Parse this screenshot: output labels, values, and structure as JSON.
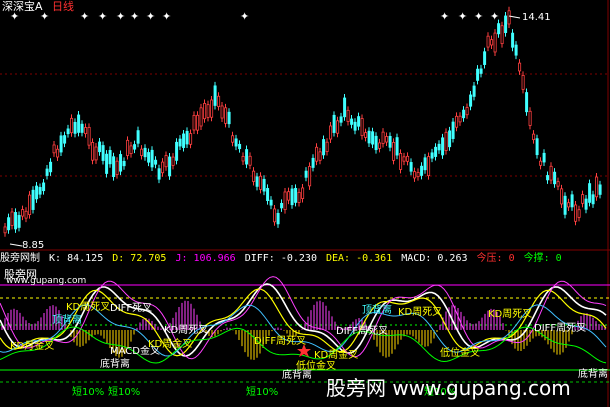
{
  "header": {
    "stock": "深深宝A",
    "period": "日线"
  },
  "price_chart": {
    "high_label": "14.41",
    "low_label": "8.85",
    "colors": {
      "up": "#ff4040",
      "down": "#40ffff",
      "star": "#ffffff",
      "grid": "#800000"
    }
  },
  "indicator_readout": {
    "name": "股旁网制",
    "k": "K: 84.125",
    "d": "D: 72.705",
    "j": "J: 106.966",
    "diff": "DIFF: -0.230",
    "dea": "DEA: -0.361",
    "macd": "MACD: 0.263",
    "jinya": "今压: 0",
    "jincheng": "今撑: 0"
  },
  "indicator_panel": {
    "watermark_small": "股旁网",
    "watermark_url": "www.gupang.com",
    "signals": [
      {
        "text": "KD周死叉",
        "color": "#ffff00"
      },
      {
        "text": "DIFF死叉",
        "color": "#ffffff"
      },
      {
        "text": "顶背离",
        "color": "#40ffff"
      },
      {
        "text": "顶背离",
        "color": "#40ffff"
      },
      {
        "text": "DIFF周死叉",
        "color": "#ffff00"
      },
      {
        "text": "KD周死叉",
        "color": "#ffff00"
      },
      {
        "text": "KD周死叉",
        "color": "#ffff00"
      },
      {
        "text": "KD周死叉",
        "color": "#ffffff"
      },
      {
        "text": "DIFF周死叉",
        "color": "#ffffff"
      },
      {
        "text": "KD月金叉",
        "color": "#ffff00"
      },
      {
        "text": "MACD金叉",
        "color": "#ffffff"
      },
      {
        "text": "KD周金叉",
        "color": "#ffff00"
      },
      {
        "text": "底背离",
        "color": "#ffffff"
      },
      {
        "text": "DIFF周死叉",
        "color": "#ffffff"
      },
      {
        "text": "KD周金叉",
        "color": "#ffff00"
      },
      {
        "text": "低位金叉",
        "color": "#ffff00"
      },
      {
        "text": "低位金叉",
        "color": "#ffff00"
      },
      {
        "text": "底背离",
        "color": "#ffffff"
      },
      {
        "text": "底背离",
        "color": "#ffffff"
      },
      {
        "text": "短10%",
        "color": "#00ff00"
      },
      {
        "text": "短10%",
        "color": "#00ff00"
      },
      {
        "text": "短10%",
        "color": "#00ff00"
      },
      {
        "text": "短10%",
        "color": "#00ff00"
      }
    ]
  },
  "watermark_big": "股旁网 www.gupang.com"
}
